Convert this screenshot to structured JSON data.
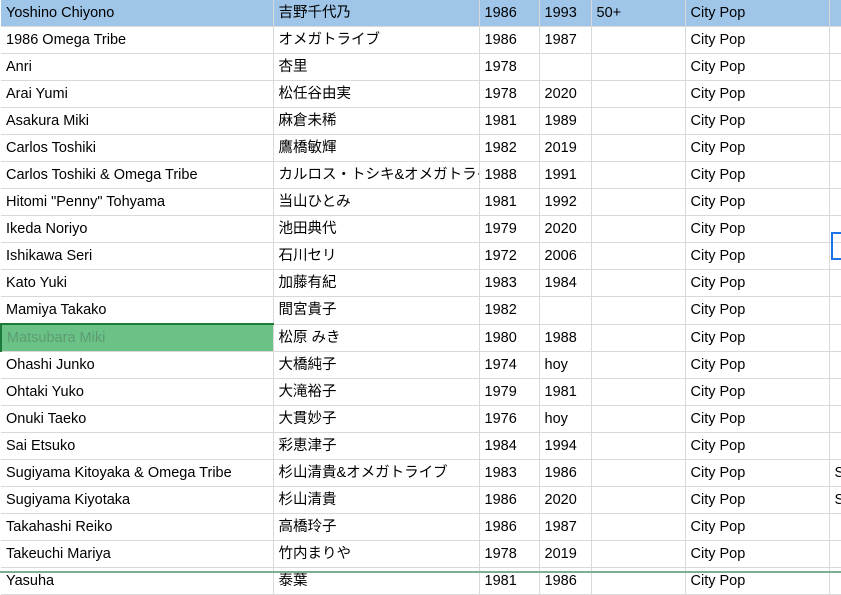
{
  "spreadsheet": {
    "columns": [
      {
        "key": "name",
        "sample": "Yoshino Chiyono"
      },
      {
        "key": "name_jp",
        "sample": "吉野千代乃"
      },
      {
        "key": "year_from",
        "sample": "1986"
      },
      {
        "key": "year_to",
        "sample": "1993"
      },
      {
        "key": "age",
        "sample": "50+"
      },
      {
        "key": "genre",
        "sample": "City Pop"
      }
    ],
    "header_row": {
      "name": "Yoshino Chiyono",
      "name_jp": "吉野千代乃",
      "year_from": "1986",
      "year_to": "1993",
      "age": "50+",
      "genre": "City Pop",
      "extra": ""
    },
    "rows": [
      {
        "name": "1986 Omega Tribe",
        "name_jp": "オメガトライブ",
        "year_from": "1986",
        "year_to": "1987",
        "age": "",
        "genre": "City Pop",
        "extra": ""
      },
      {
        "name": "Anri",
        "name_jp": "杏里",
        "year_from": "1978",
        "year_to": "",
        "age": "",
        "genre": "City Pop",
        "extra": ""
      },
      {
        "name": "Arai Yumi",
        "name_jp": "松任谷由実",
        "year_from": "1978",
        "year_to": "2020",
        "age": "",
        "genre": "City Pop",
        "extra": ""
      },
      {
        "name": "Asakura Miki",
        "name_jp": "麻倉未稀",
        "year_from": "1981",
        "year_to": "1989",
        "age": "",
        "genre": "City Pop",
        "extra": ""
      },
      {
        "name": "Carlos Toshiki",
        "name_jp": "鷹橋敏輝",
        "year_from": "1982",
        "year_to": "2019",
        "age": "",
        "genre": "City Pop",
        "extra": ""
      },
      {
        "name": "Carlos Toshiki & Omega Tribe",
        "name_jp": "カルロス・トシキ&オメガトライブ",
        "year_from": "1988",
        "year_to": "1991",
        "age": "",
        "genre": "City Pop",
        "extra": ""
      },
      {
        "name": "Hitomi \"Penny\" Tohyama",
        "name_jp": "当山ひとみ",
        "year_from": "1981",
        "year_to": "1992",
        "age": "",
        "genre": "City Pop",
        "extra": ""
      },
      {
        "name": "Ikeda Noriyo",
        "name_jp": "池田典代",
        "year_from": "1979",
        "year_to": "2020",
        "age": "",
        "genre": "City Pop",
        "extra": ""
      },
      {
        "name": "Ishikawa Seri",
        "name_jp": "石川セリ",
        "year_from": "1972",
        "year_to": "2006",
        "age": "",
        "genre": "City Pop",
        "extra": ""
      },
      {
        "name": "Kato Yuki",
        "name_jp": "加藤有紀",
        "year_from": "1983",
        "year_to": "1984",
        "age": "",
        "genre": "City Pop",
        "extra": ""
      },
      {
        "name": "Mamiya Takako",
        "name_jp": "間宮貴子",
        "year_from": "1982",
        "year_to": "",
        "age": "",
        "genre": "City Pop",
        "extra": ""
      },
      {
        "name": "Matsubara Miki",
        "name_jp": "松原 みき",
        "year_from": "1980",
        "year_to": "1988",
        "age": "",
        "genre": "City Pop",
        "extra": "",
        "selected": true
      },
      {
        "name": "Ohashi Junko",
        "name_jp": "大橋純子",
        "year_from": "1974",
        "year_to": "hoy",
        "age": "",
        "genre": "City Pop",
        "extra": ""
      },
      {
        "name": "Ohtaki Yuko",
        "name_jp": "大滝裕子",
        "year_from": "1979",
        "year_to": "1981",
        "age": "",
        "genre": "City Pop",
        "extra": ""
      },
      {
        "name": "Onuki Taeko",
        "name_jp": "大貫妙子",
        "year_from": "1976",
        "year_to": "hoy",
        "age": "",
        "genre": "City Pop",
        "extra": ""
      },
      {
        "name": "Sai Etsuko",
        "name_jp": "彩恵津子",
        "year_from": "1984",
        "year_to": "1994",
        "age": "",
        "genre": "City Pop",
        "extra": ""
      },
      {
        "name": "Sugiyama Kitoyaka & Omega Tribe",
        "name_jp": "杉山清貴&オメガトライブ",
        "year_from": "1983",
        "year_to": "1986",
        "age": "",
        "genre": "City Pop",
        "extra": "S"
      },
      {
        "name": "Sugiyama Kiyotaka",
        "name_jp": "杉山清貴",
        "year_from": "1986",
        "year_to": "2020",
        "age": "",
        "genre": "City Pop",
        "extra": "S"
      },
      {
        "name": "Takahashi Reiko",
        "name_jp": "高橋玲子",
        "year_from": "1986",
        "year_to": "1987",
        "age": "",
        "genre": "City Pop",
        "extra": ""
      },
      {
        "name": "Takeuchi Mariya",
        "name_jp": "竹内まりや",
        "year_from": "1978",
        "year_to": "2019",
        "age": "",
        "genre": "City Pop",
        "extra": ""
      },
      {
        "name": "Yasuha",
        "name_jp": "泰葉",
        "year_from": "1981",
        "year_to": "1986",
        "age": "",
        "genre": "City Pop",
        "extra": ""
      }
    ],
    "colors": {
      "header_fill": "#9fc5e8",
      "selection_fill": "#6ac287",
      "selection_border": "#1c7a38",
      "column_divider": "#1e7b34",
      "gridline": "#d9d9d9",
      "active_cell_border": "#1a73e8"
    }
  }
}
